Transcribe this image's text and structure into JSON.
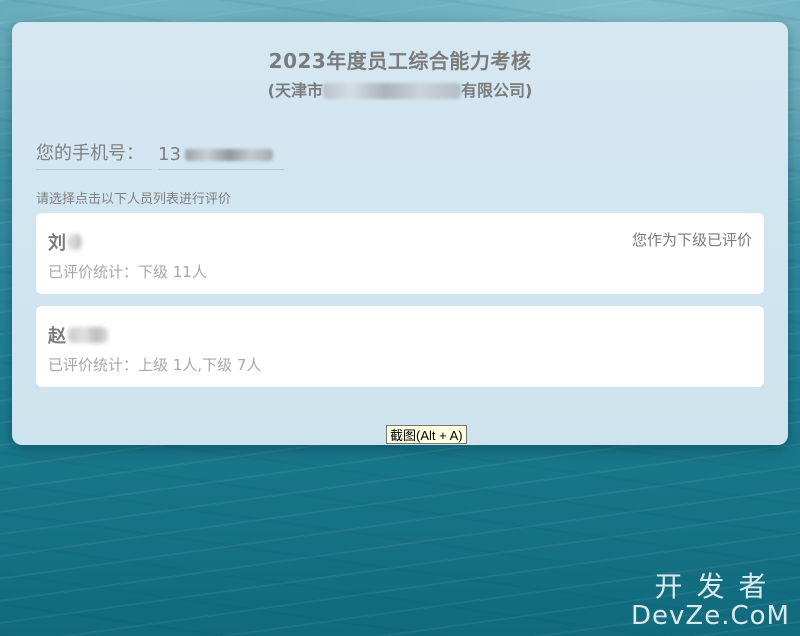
{
  "card": {
    "title": "2023年度员工综合能力考核",
    "subtitle_prefix": "(天津市",
    "subtitle_suffix": "有限公司)"
  },
  "phone": {
    "label": "您的手机号：",
    "value_prefix": "13"
  },
  "hint": "请选择点击以下人员列表进行评价",
  "persons": [
    {
      "name": "刘",
      "stats": "已评价统计：下级 11人",
      "status": "您作为下级已评价"
    },
    {
      "name": "赵",
      "stats": "已评价统计：上级 1人,下级 7人",
      "status": ""
    }
  ],
  "tooltip": "截图(Alt + A)",
  "watermark": {
    "line1": "开发者",
    "line2": "DevZe.CoM"
  },
  "colors": {
    "card_bg": "#d2e6f1",
    "text_gray": "#7b7b7b",
    "tooltip_bg": "#ffffe1"
  }
}
